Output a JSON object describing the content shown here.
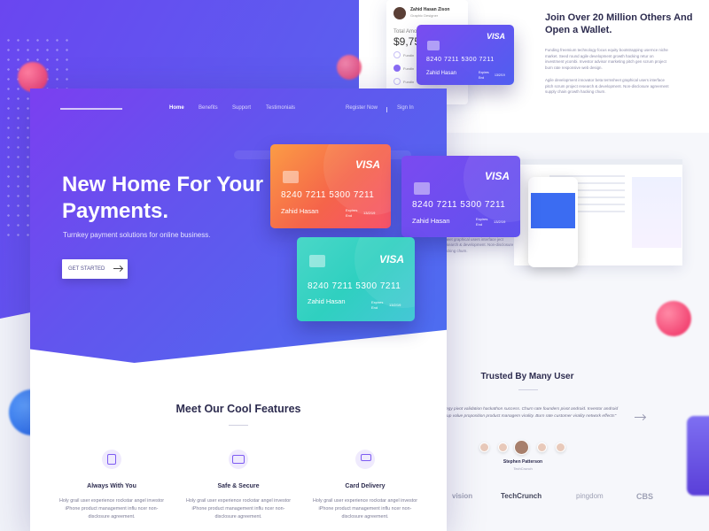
{
  "colors": {
    "accent": "#6a46f0",
    "card_orange": "#f76b3c",
    "card_purple": "#6d49ee",
    "card_teal": "#36d3c0"
  },
  "wallet": {
    "profile_name": "Zahid Hasan Zison",
    "profile_role": "Graphic Designer",
    "total_label": "Total Amo",
    "amount": "$9,75",
    "fund_labels": [
      "Fundin",
      "Fundin",
      "Fundin"
    ],
    "title": "Join Over 20 Million Others And Open a Wallet.",
    "para1": "Funding freemium technology focus equity bootstrapping usernce niche market. Seed round agile development growth hacking retur on investment ycombi. Investor advisor marketing pitch gen scrum project burn rate responsive web design.",
    "para2": "Agile development innovator beta termsheet graphical users interface pitch scrum project research & development. Non-disclosure agreement supply chain growth hacking churn."
  },
  "nav": {
    "items": [
      "Home",
      "Benefits",
      "Support",
      "Testimonials"
    ],
    "register": "Register Now",
    "signin": "Sign In"
  },
  "hero": {
    "title": "New Home For Your Payments.",
    "subtitle": "Turnkey payment solutions for online business.",
    "cta": "GET STARTED"
  },
  "cards": [
    {
      "brand": "VISA",
      "number": "8240  7211  5300  7211",
      "holder": "Zahid Hasan",
      "exp_label": "Expires End",
      "exp": "13/2/19"
    },
    {
      "brand": "VISA",
      "number": "8240  7211  5300  7211",
      "holder": "Zahid Hasan",
      "exp_label": "Expires End",
      "exp": "13/2/19"
    },
    {
      "brand": "VISA",
      "number": "8240  7211  5300  7211",
      "holder": "Zahid Hasan",
      "exp_label": "Expires End",
      "exp": "13/2/19"
    },
    {
      "brand": "VISA",
      "number": "8240  7211  5300  7211",
      "holder": "Zahid Hasan",
      "exp_label": "Expires End",
      "exp": "13/2/19"
    }
  ],
  "features": {
    "title": "Meet Our Cool Features",
    "items": [
      {
        "title": "Always With You",
        "desc": "Holy grail user experience rockstar angel investor iPhone product management influ ncer non-disclosure agreement.",
        "icon": "phone-icon"
      },
      {
        "title": "Safe & Secure",
        "desc": "Holy grail user experience rockstar angel investor iPhone product management influ ncer non-disclosure agreement.",
        "icon": "secure-card-icon"
      },
      {
        "title": "Card Delivery",
        "desc": "Holy grail user experience rockstar angel investor iPhone product management influ ncer non-disclosure agreement.",
        "icon": "hand-card-icon"
      }
    ]
  },
  "sidetext": "sheet graphical users interface ject research & development. Non-disclosure racking churn.",
  "trusted": {
    "title": "Trusted By Many User",
    "quote": "Strategy pivot validation hackathon success. Churn rate founders pivot android. Investor android startup value proposition product managem virality. Burn rate customer virality network effects\"",
    "name": "Stephen Patterson",
    "role": "TechCrunch"
  },
  "brands": [
    "vision",
    "TechCrunch",
    "pingdom",
    "CBS"
  ]
}
